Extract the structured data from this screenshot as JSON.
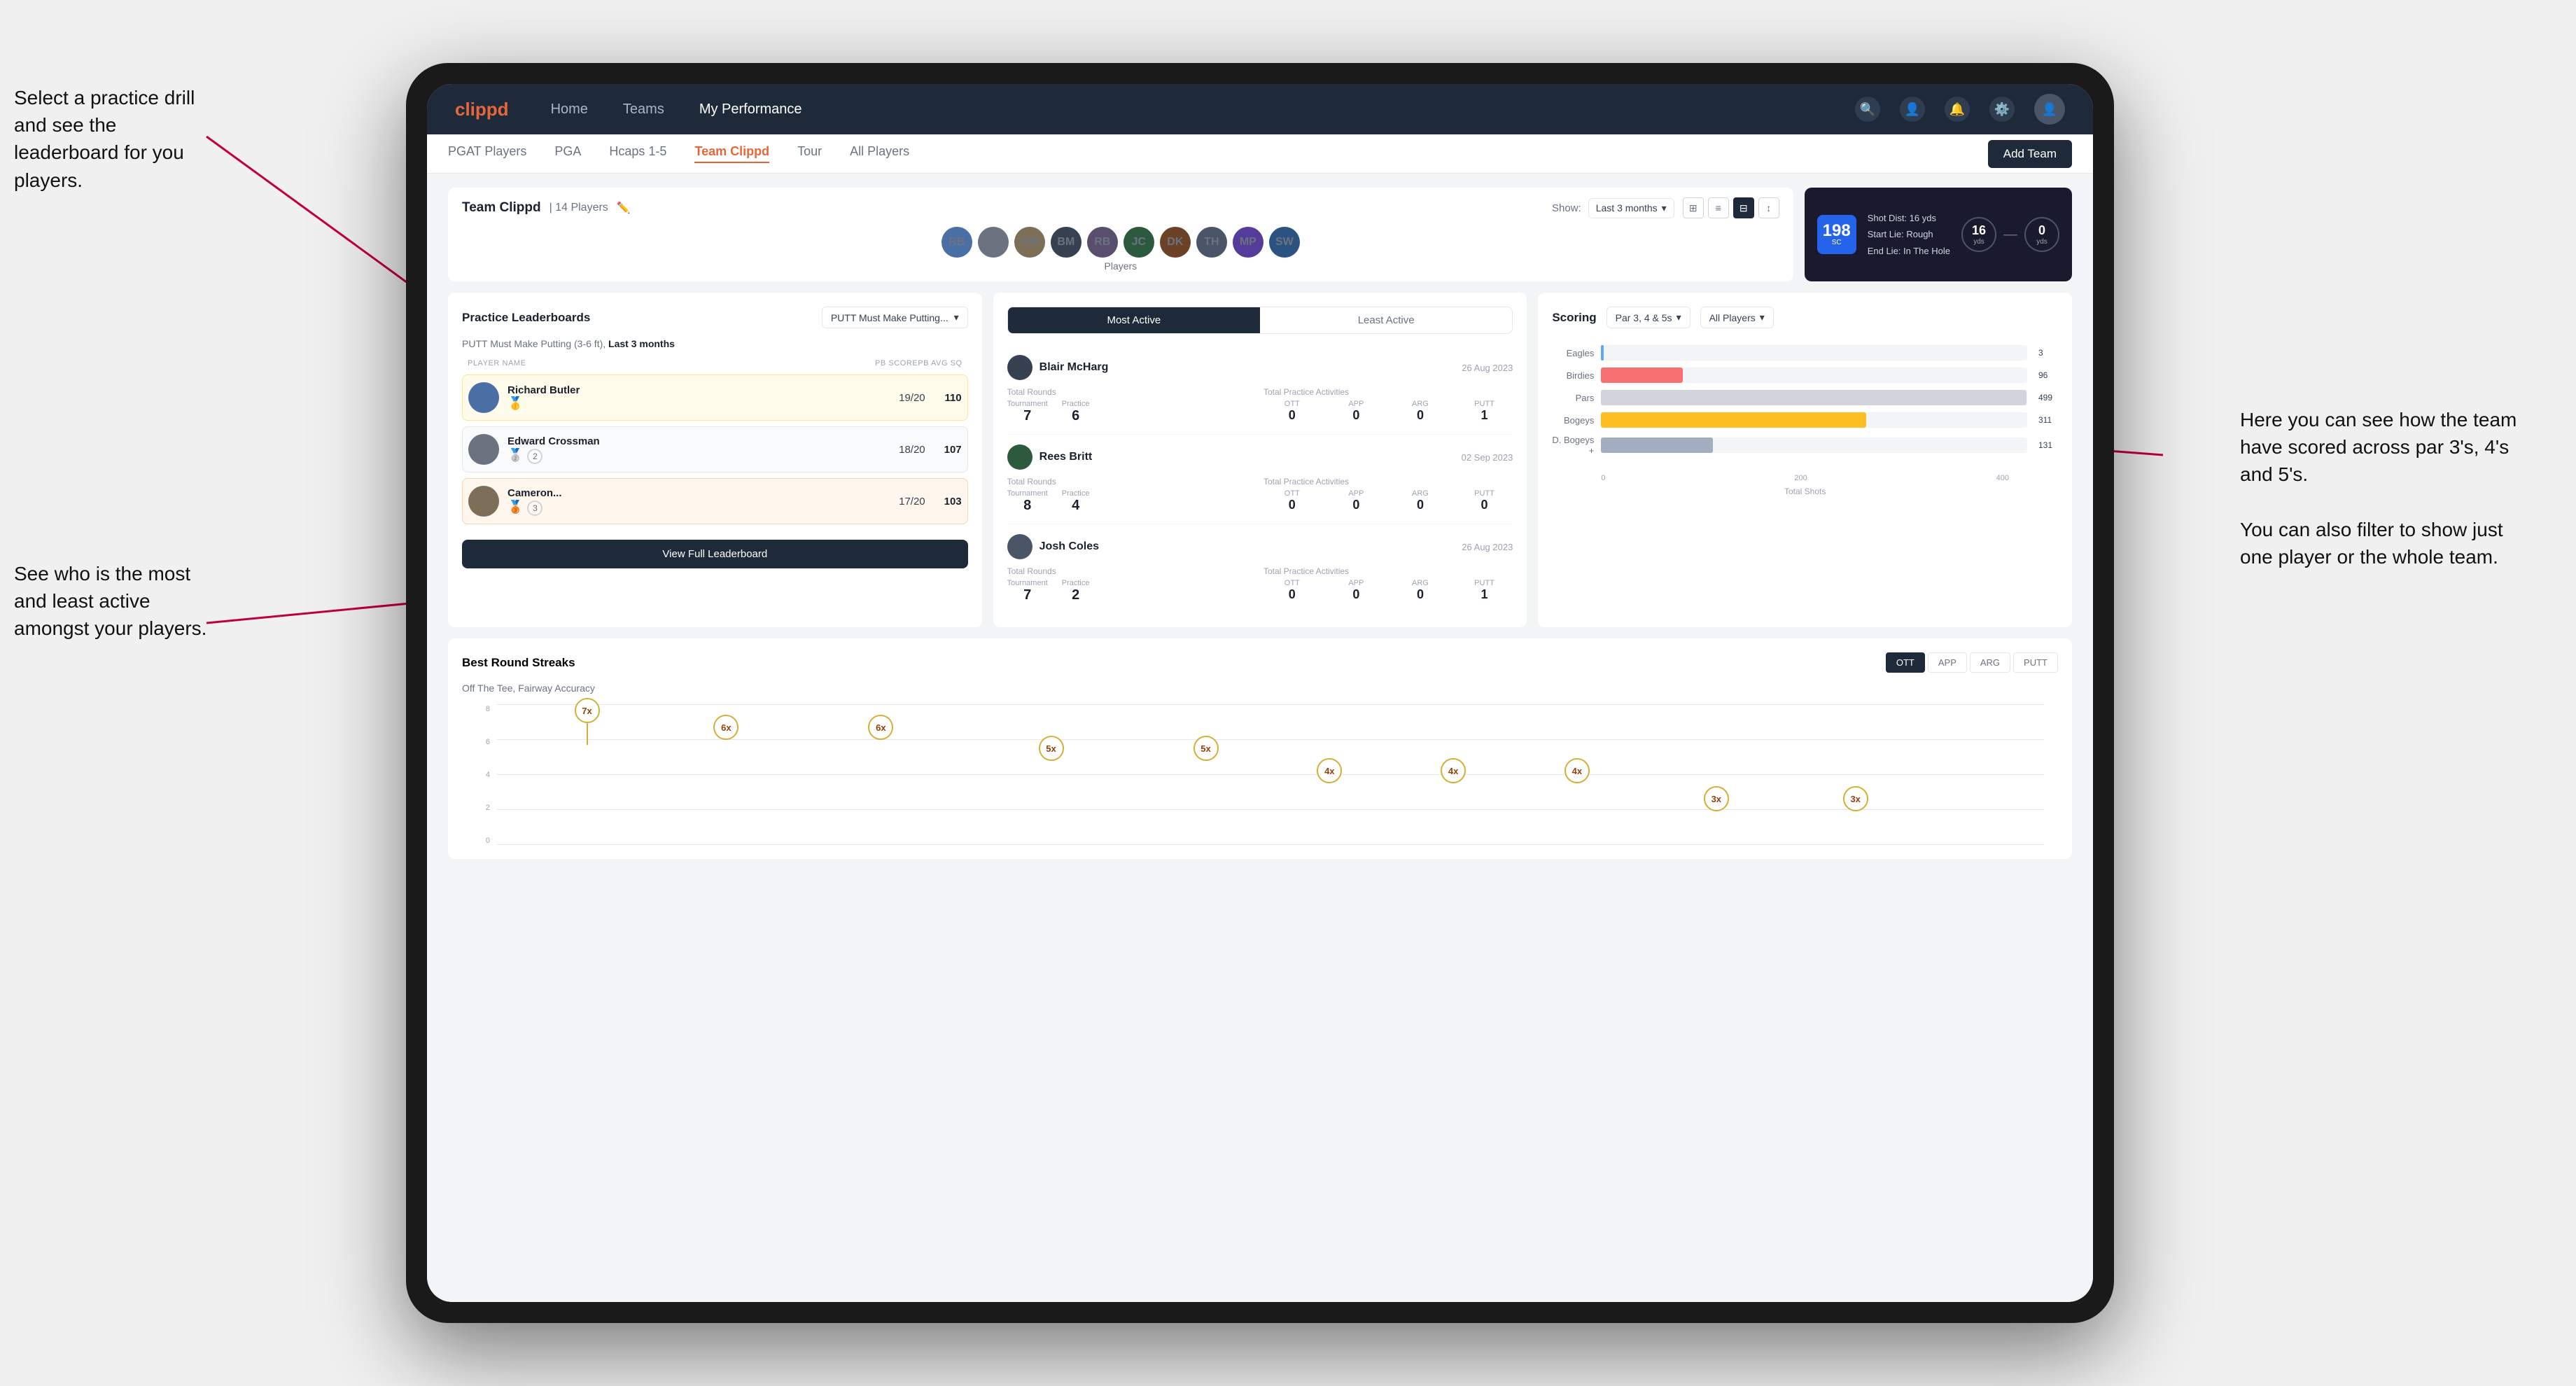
{
  "annotations": {
    "top_left": "Select a practice drill and see the leaderboard for you players.",
    "bottom_left": "See who is the most and least active amongst your players.",
    "right": "Here you can see how the team have scored across par 3's, 4's and 5's.\n\nYou can also filter to show just one player or the whole team."
  },
  "nav": {
    "logo": "clippd",
    "links": [
      "Home",
      "Teams",
      "My Performance"
    ],
    "active_link": "Teams"
  },
  "sub_nav": {
    "links": [
      "PGAT Players",
      "PGA",
      "Hcaps 1-5",
      "Team Clippd",
      "Tour",
      "All Players"
    ],
    "active_link": "Team Clippd",
    "add_team_label": "Add Team"
  },
  "team_header": {
    "title": "Team Clippd",
    "player_count": "14 Players",
    "show_label": "Show:",
    "period": "Last 3 months",
    "players_label": "Players"
  },
  "shot_card": {
    "badge_num": "198",
    "badge_label": "SC",
    "shot_dist": "Shot Dist: 16 yds",
    "start_lie": "Start Lie: Rough",
    "end_lie": "End Lie: In The Hole",
    "yds_left": "16",
    "yds_left_label": "yds",
    "yds_right": "0",
    "yds_right_label": "yds"
  },
  "practice_leaderboard": {
    "title": "Practice Leaderboards",
    "drill_name": "PUTT Must Make Putting...",
    "drill_full": "PUTT Must Make Putting (3-6 ft)",
    "period": "Last 3 months",
    "columns": [
      "PLAYER NAME",
      "PB SCORE",
      "PB AVG SQ"
    ],
    "players": [
      {
        "name": "Richard Butler",
        "score": "19/20",
        "avg": "110",
        "rank": 1,
        "medal": "🥇"
      },
      {
        "name": "Edward Crossman",
        "score": "18/20",
        "avg": "107",
        "rank": 2,
        "medal": "🥈"
      },
      {
        "name": "Cameron...",
        "score": "17/20",
        "avg": "103",
        "rank": 3,
        "medal": "🥉"
      }
    ],
    "view_full_label": "View Full Leaderboard"
  },
  "activity": {
    "tabs": [
      "Most Active",
      "Least Active"
    ],
    "active_tab": "Most Active",
    "players": [
      {
        "name": "Blair McHarg",
        "date": "26 Aug 2023",
        "total_rounds_label": "Total Rounds",
        "tournament_label": "Tournament",
        "tournament_val": "7",
        "practice_label": "Practice",
        "practice_val": "6",
        "total_practice_label": "Total Practice Activities",
        "ott": "0",
        "app": "0",
        "arg": "0",
        "putt": "1"
      },
      {
        "name": "Rees Britt",
        "date": "02 Sep 2023",
        "total_rounds_label": "Total Rounds",
        "tournament_label": "Tournament",
        "tournament_val": "8",
        "practice_label": "Practice",
        "practice_val": "4",
        "total_practice_label": "Total Practice Activities",
        "ott": "0",
        "app": "0",
        "arg": "0",
        "putt": "0"
      },
      {
        "name": "Josh Coles",
        "date": "26 Aug 2023",
        "total_rounds_label": "Total Rounds",
        "tournament_label": "Tournament",
        "tournament_val": "7",
        "practice_label": "Practice",
        "practice_val": "2",
        "total_practice_label": "Total Practice Activities",
        "ott": "0",
        "app": "0",
        "arg": "0",
        "putt": "1"
      }
    ]
  },
  "scoring": {
    "title": "Scoring",
    "filter1": "Par 3, 4 & 5s",
    "filter2": "All Players",
    "bars": [
      {
        "label": "Eagles",
        "value": 3,
        "max": 500,
        "color": "#60a5fa",
        "class": "bar-eagles"
      },
      {
        "label": "Birdies",
        "value": 96,
        "max": 500,
        "color": "#f87171",
        "class": "bar-birdies"
      },
      {
        "label": "Pars",
        "value": 499,
        "max": 500,
        "color": "#d1d5db",
        "class": "bar-pars"
      },
      {
        "label": "Bogeys",
        "value": 311,
        "max": 500,
        "color": "#fbbf24",
        "class": "bar-bogeys"
      },
      {
        "label": "D. Bogeys +",
        "value": 131,
        "max": 500,
        "color": "#e5e7eb",
        "class": "bar-doublebogeys"
      }
    ],
    "axis_labels": [
      "0",
      "200",
      "400"
    ],
    "total_shots_label": "Total Shots"
  },
  "streaks": {
    "title": "Best Round Streaks",
    "subtitle": "Off The Tee, Fairway Accuracy",
    "filter_btns": [
      "OTT",
      "APP",
      "ARG",
      "PUTT"
    ],
    "active_btn": "OTT",
    "data_points": [
      {
        "x_pct": 6,
        "y_pct": 78,
        "label": "7x"
      },
      {
        "x_pct": 18,
        "y_pct": 60,
        "label": "6x"
      },
      {
        "x_pct": 28,
        "y_pct": 60,
        "label": "6x"
      },
      {
        "x_pct": 38,
        "y_pct": 44,
        "label": "5x"
      },
      {
        "x_pct": 48,
        "y_pct": 44,
        "label": "5x"
      },
      {
        "x_pct": 57,
        "y_pct": 28,
        "label": "4x"
      },
      {
        "x_pct": 65,
        "y_pct": 28,
        "label": "4x"
      },
      {
        "x_pct": 73,
        "y_pct": 28,
        "label": "4x"
      },
      {
        "x_pct": 81,
        "y_pct": 12,
        "label": "3x"
      },
      {
        "x_pct": 90,
        "y_pct": 12,
        "label": "3x"
      }
    ]
  }
}
